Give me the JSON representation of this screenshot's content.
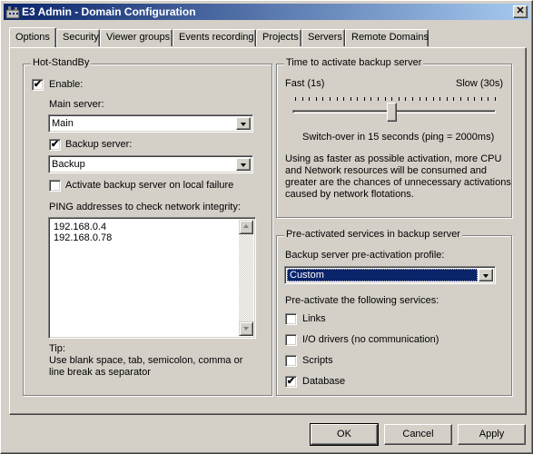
{
  "window": {
    "title": "E3 Admin - Domain Configuration",
    "close_glyph": "✕"
  },
  "tabs": [
    {
      "label": "Options",
      "active": true
    },
    {
      "label": "Security"
    },
    {
      "label": "Viewer groups"
    },
    {
      "label": "Events recording"
    },
    {
      "label": "Projects"
    },
    {
      "label": "Servers"
    },
    {
      "label": "Remote Domains"
    }
  ],
  "hot_standby": {
    "title": "Hot-StandBy",
    "enable_label": "Enable:",
    "enable_checked": true,
    "main_server_label": "Main server:",
    "main_server_value": "Main",
    "backup_server_label": "Backup server:",
    "backup_server_checked": true,
    "backup_server_value": "Backup",
    "activate_local_failure_label": "Activate backup server on local failure",
    "activate_local_failure_checked": false,
    "ping_label": "PING addresses to check network integrity:",
    "ping_addresses": [
      "192.168.0.4",
      "192.168.0.78"
    ],
    "tip_title": "Tip:",
    "tip_line1": "Use blank space, tab, semicolon, comma or",
    "tip_line2": "line break as separator"
  },
  "activation_time": {
    "title": "Time to activate backup server",
    "fast_label": "Fast (1s)",
    "slow_label": "Slow (30s)",
    "slider_fraction": 0.48,
    "switchover_text": "Switch-over in 15 seconds (ping = 2000ms)",
    "desc_line1": "Using as faster as possible activation, more CPU",
    "desc_line2": "and Network resources will be consumed and",
    "desc_line3": "greater are the chances of unnecessary activations",
    "desc_line4": "caused by network flotations."
  },
  "preactivated": {
    "title": "Pre-activated services in backup server",
    "profile_label": "Backup server pre-activation profile:",
    "profile_value": "Custom",
    "services_label": "Pre-activate the following services:",
    "services": [
      {
        "label": "Links",
        "checked": false
      },
      {
        "label": "I/O drivers (no communication)",
        "checked": false
      },
      {
        "label": "Scripts",
        "checked": false
      },
      {
        "label": "Database",
        "checked": true
      }
    ]
  },
  "buttons": {
    "ok": "OK",
    "cancel": "Cancel",
    "apply": "Apply"
  },
  "check_glyph": "✔",
  "colors": {
    "titlebar_start": "#0a246a",
    "titlebar_end": "#a6caf0",
    "face": "#d4d0c8",
    "selection": "#0a246a"
  }
}
